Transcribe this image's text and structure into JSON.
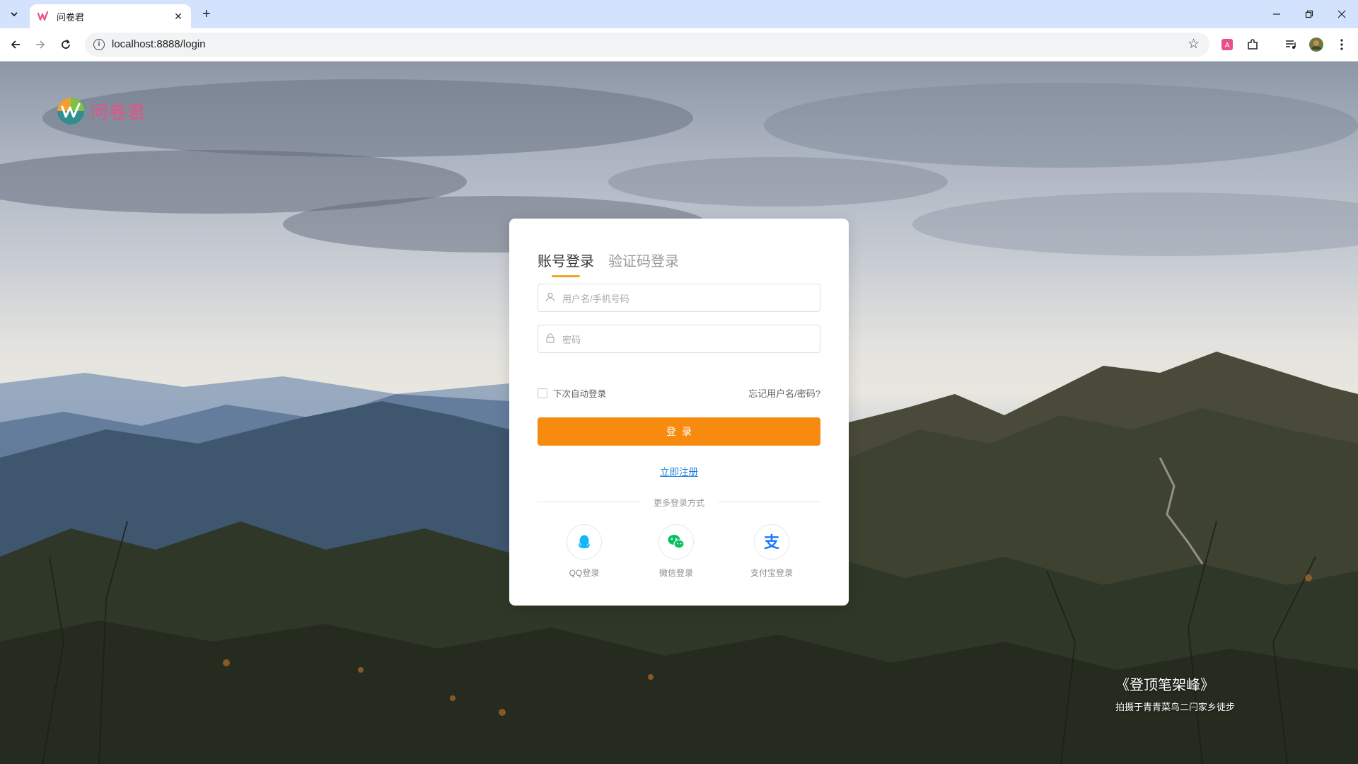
{
  "browser": {
    "tab_title": "问卷君",
    "url": "localhost:8888/login"
  },
  "brand": {
    "name": "问卷君",
    "color": "#e8508a"
  },
  "login": {
    "tabs": [
      {
        "label": "账号登录",
        "active": true
      },
      {
        "label": "验证码登录",
        "active": false
      }
    ],
    "username_placeholder": "用户名/手机号码",
    "password_placeholder": "密码",
    "remember_label": "下次自动登录",
    "forgot_link": "忘记用户名/密码?",
    "submit_label": "登录",
    "register_link": "立即注册",
    "more_methods_label": "更多登录方式",
    "social": [
      {
        "label": "QQ登录",
        "icon": "qq-icon",
        "color": "#12b7f5"
      },
      {
        "label": "微信登录",
        "icon": "wechat-icon",
        "color": "#07c160"
      },
      {
        "label": "支付宝登录",
        "icon": "alipay-icon",
        "color": "#1677ff"
      }
    ],
    "accent_color": "#f68b0f"
  },
  "photo": {
    "title": "《登顶笔架峰》",
    "subtitle": "拍摄于青青菜鸟二闩家乡徒步"
  }
}
